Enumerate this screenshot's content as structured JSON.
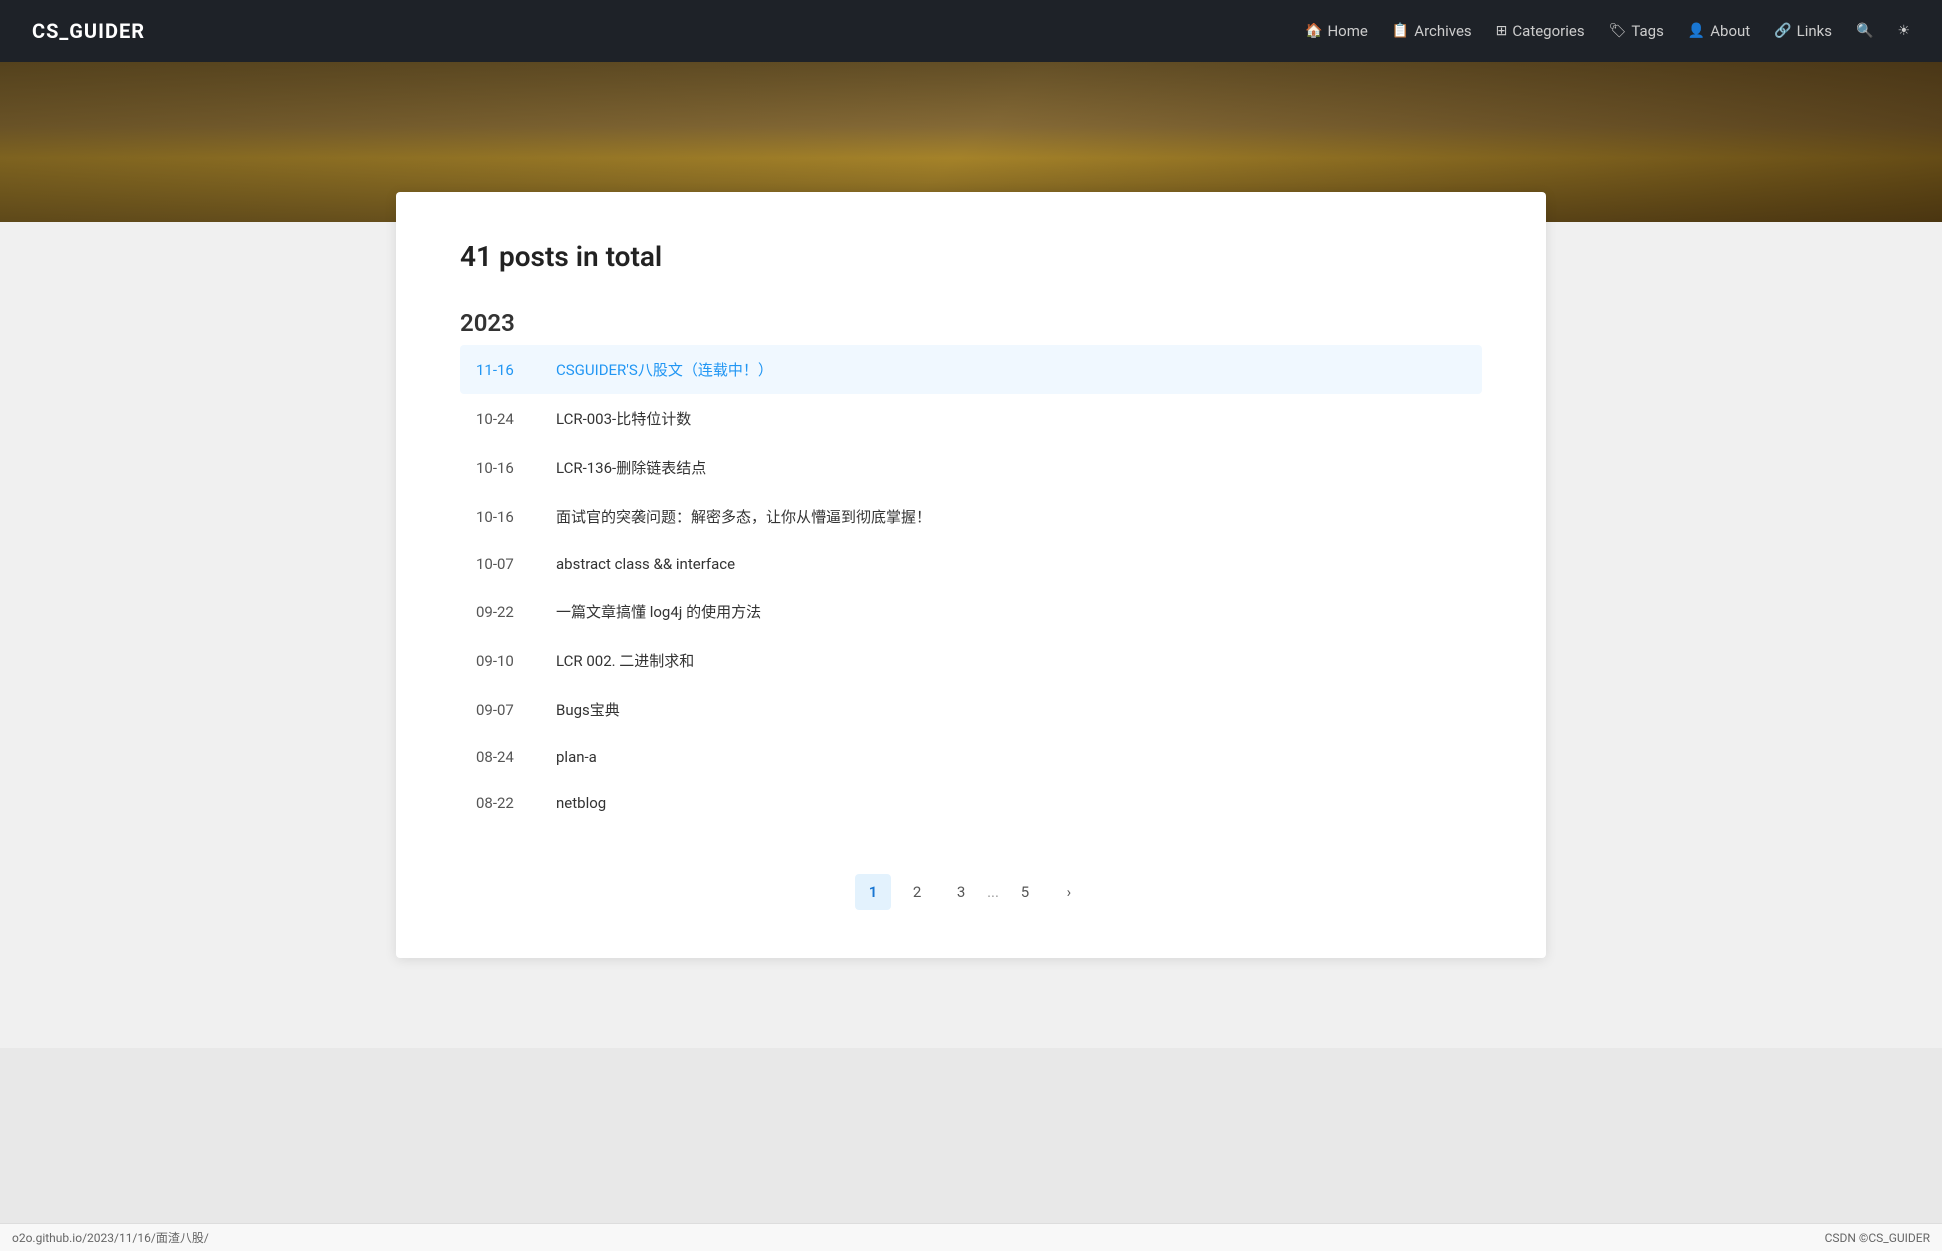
{
  "brand": "CS_GUIDER",
  "nav": {
    "links": [
      {
        "id": "home",
        "icon": "🏠",
        "label": "Home"
      },
      {
        "id": "archives",
        "icon": "📋",
        "label": "Archives"
      },
      {
        "id": "categories",
        "icon": "⚏",
        "label": "Categories"
      },
      {
        "id": "tags",
        "icon": "🏷",
        "label": "Tags"
      },
      {
        "id": "about",
        "icon": "👤",
        "label": "About"
      },
      {
        "id": "links",
        "icon": "🔗",
        "label": "Links"
      },
      {
        "id": "search",
        "icon": "🔍",
        "label": ""
      },
      {
        "id": "theme",
        "icon": "☀",
        "label": ""
      }
    ]
  },
  "posts_summary": "41 posts in total",
  "year": "2023",
  "posts": [
    {
      "date": "11-16",
      "title": "CSGUIDER'S八股文（连载中！）",
      "highlighted": true
    },
    {
      "date": "10-24",
      "title": "LCR-003-比特位计数",
      "highlighted": false
    },
    {
      "date": "10-16",
      "title": "LCR-136-删除链表结点",
      "highlighted": false
    },
    {
      "date": "10-16",
      "title": "面试官的突袭问题：解密多态，让你从懵逼到彻底掌握！",
      "highlighted": false
    },
    {
      "date": "10-07",
      "title": "abstract class && interface",
      "highlighted": false
    },
    {
      "date": "09-22",
      "title": "一篇文章搞懂 log4j 的使用方法",
      "highlighted": false
    },
    {
      "date": "09-10",
      "title": "LCR 002. 二进制求和",
      "highlighted": false
    },
    {
      "date": "09-07",
      "title": "Bugs宝典",
      "highlighted": false
    },
    {
      "date": "08-24",
      "title": "plan-a",
      "highlighted": false
    },
    {
      "date": "08-22",
      "title": "netblog",
      "highlighted": false
    }
  ],
  "pagination": {
    "pages": [
      "1",
      "2",
      "3",
      "5"
    ],
    "active": "1",
    "dots": "...",
    "next_icon": "›"
  },
  "status_bar": {
    "url": "o2o.github.io/2023/11/16/面渣八股/",
    "copyright": "CSDN ©CS_GUIDER"
  }
}
